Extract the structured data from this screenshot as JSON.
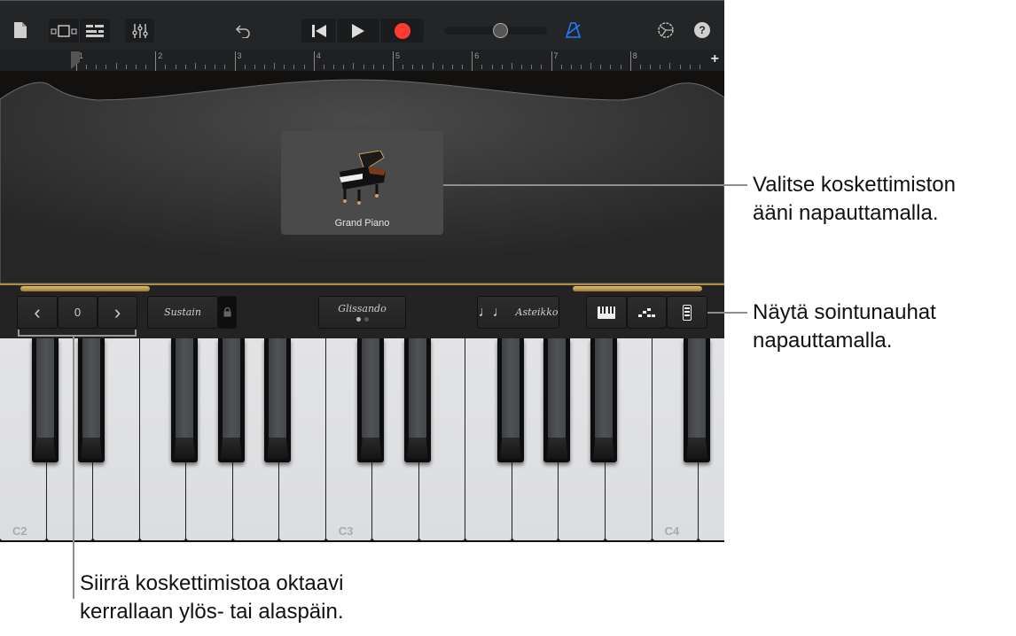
{
  "toolbar": {
    "icons": {
      "my_songs": "document-icon",
      "view_browser": "tracks-view-icon",
      "view_tracks": "track-list-icon",
      "mixer": "mixer-sliders-icon",
      "undo": "undo-icon",
      "go_to_start": "skip-back-icon",
      "play": "play-icon",
      "record": "record-icon",
      "volume": "volume-slider",
      "metronome": "metronome-icon",
      "settings": "settings-gear-icon",
      "help": "help-icon"
    },
    "help_label": "?",
    "volume_level": 0.55,
    "record_color": "#ff3b30",
    "metronome_color": "#1e7dff"
  },
  "ruler": {
    "bars": [
      "1",
      "2",
      "3",
      "4",
      "5",
      "6",
      "7",
      "8"
    ],
    "add_label": "+"
  },
  "instrument": {
    "name": "Grand Piano",
    "icon": "grand-piano-icon"
  },
  "controls": {
    "octave_down": "‹",
    "octave_value": "0",
    "octave_up": "›",
    "sustain_label": "Sustain",
    "glissando_label": "Glissando",
    "glissando_page": 1,
    "glissando_pages": 2,
    "scale_icon": "♩♩",
    "scale_label": "Asteikko",
    "keyboard_mode_icon": "keyboard-icon",
    "arpeggio_icon": "arpeggiator-icon",
    "chord_strips_icon": "chord-strips-icon",
    "accent": "#b08d45"
  },
  "keyboard": {
    "white_keys": [
      "C2",
      "D2",
      "E2",
      "F2",
      "G2",
      "A2",
      "B2",
      "C3",
      "D3",
      "E3",
      "F3",
      "G3",
      "A3",
      "B3",
      "C4",
      "D4"
    ],
    "labels": {
      "0": "C2",
      "7": "C3",
      "14": "C4"
    },
    "black_after_white": [
      0,
      1,
      3,
      4,
      5,
      7,
      8,
      10,
      11,
      12,
      14
    ]
  },
  "callouts": {
    "sound": "Valitse koskettimiston\nääni napauttamalla.",
    "chords": "Näytä sointunauhat\nnapauttamalla.",
    "octave": "Siirrä koskettimistoa oktaavi\nkerrallaan ylös- tai alaspäin."
  }
}
